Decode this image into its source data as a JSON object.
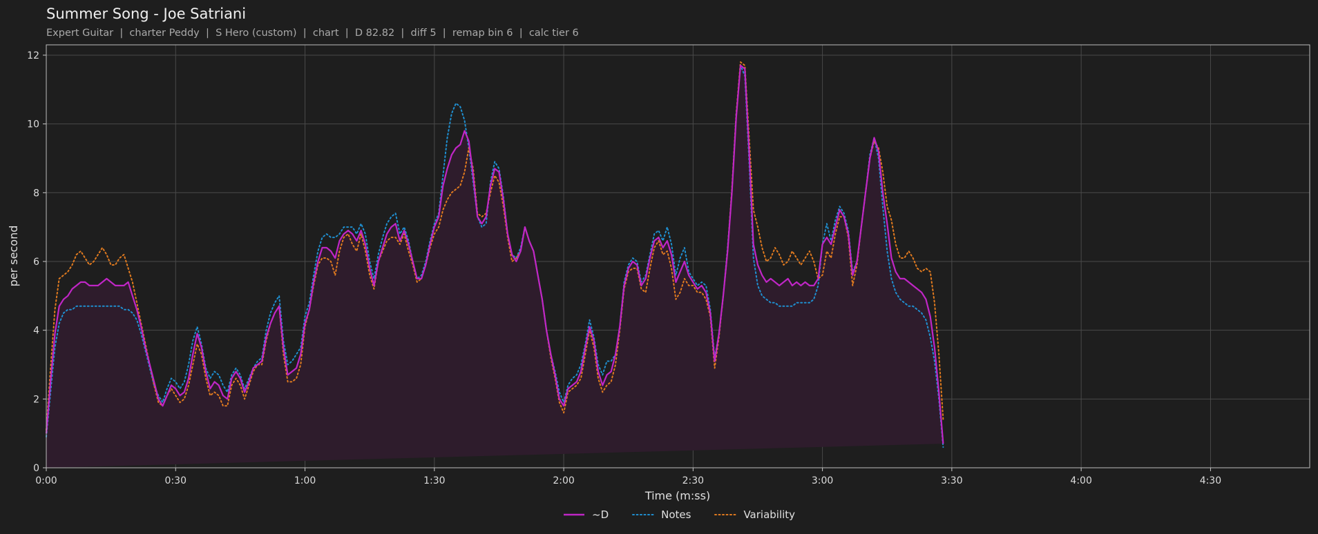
{
  "header": {
    "title": "Summer Song - Joe Satriani",
    "subtitle": "Expert Guitar  |  charter Peddy  |  S Hero (custom)  |  chart  |  D 82.82  |  diff 5  |  remap bin 6  |  calc tier 6"
  },
  "colors": {
    "background": "#1e1e1e",
    "grid": "#4a4a4a",
    "d_series": "#c026c6",
    "notes_series": "#1f8fd0",
    "variability_series": "#e07a1f",
    "fill": "#2e1c2c"
  },
  "chart_data": {
    "type": "line",
    "xlabel": "Time (m:ss)",
    "ylabel": "per second",
    "xlim": [
      0,
      293
    ],
    "ylim": [
      0,
      12.3
    ],
    "grid": true,
    "legend_placement": "bottom-center",
    "x_ticks": [
      {
        "value": 0,
        "label": "0:00"
      },
      {
        "value": 30,
        "label": "0:30"
      },
      {
        "value": 60,
        "label": "1:00"
      },
      {
        "value": 90,
        "label": "1:30"
      },
      {
        "value": 120,
        "label": "2:00"
      },
      {
        "value": 150,
        "label": "2:30"
      },
      {
        "value": 180,
        "label": "3:00"
      },
      {
        "value": 210,
        "label": "3:30"
      },
      {
        "value": 240,
        "label": "4:00"
      },
      {
        "value": 270,
        "label": "4:30"
      }
    ],
    "y_ticks": [
      {
        "value": 0,
        "label": "0"
      },
      {
        "value": 2,
        "label": "2"
      },
      {
        "value": 4,
        "label": "4"
      },
      {
        "value": 6,
        "label": "6"
      },
      {
        "value": 8,
        "label": "8"
      },
      {
        "value": 10,
        "label": "10"
      },
      {
        "value": 12,
        "label": "12"
      }
    ],
    "x": [
      0,
      1,
      2,
      3,
      4,
      5,
      6,
      7,
      8,
      9,
      10,
      11,
      12,
      13,
      14,
      15,
      16,
      17,
      18,
      19,
      20,
      21,
      22,
      23,
      24,
      25,
      26,
      27,
      28,
      29,
      30,
      31,
      32,
      33,
      34,
      35,
      36,
      37,
      38,
      39,
      40,
      41,
      42,
      43,
      44,
      45,
      46,
      47,
      48,
      49,
      50,
      51,
      52,
      53,
      54,
      55,
      56,
      57,
      58,
      59,
      60,
      61,
      62,
      63,
      64,
      65,
      66,
      67,
      68,
      69,
      70,
      71,
      72,
      73,
      74,
      75,
      76,
      77,
      78,
      79,
      80,
      81,
      82,
      83,
      84,
      85,
      86,
      87,
      88,
      89,
      90,
      91,
      92,
      93,
      94,
      95,
      96,
      97,
      98,
      99,
      100,
      101,
      102,
      103,
      104,
      105,
      106,
      107,
      108,
      109,
      110,
      111,
      112,
      113,
      114,
      115,
      116,
      117,
      118,
      119,
      120,
      121,
      122,
      123,
      124,
      125,
      126,
      127,
      128,
      129,
      130,
      131,
      132,
      133,
      134,
      135,
      136,
      137,
      138,
      139,
      140,
      141,
      142,
      143,
      144,
      145,
      146,
      147,
      148,
      149,
      150,
      151,
      152,
      153,
      154,
      155,
      156,
      157,
      158,
      159,
      160,
      161,
      162,
      163,
      164,
      165,
      166,
      167,
      168,
      169,
      170,
      171,
      172,
      173,
      174,
      175,
      176,
      177,
      178,
      179,
      180,
      181,
      182,
      183,
      184,
      185,
      186,
      187,
      188,
      189,
      190,
      191,
      192,
      193,
      194,
      195,
      196,
      197,
      198,
      199,
      200,
      201,
      202,
      203,
      204,
      205,
      206,
      207,
      208,
      209,
      210,
      211,
      212,
      213,
      214,
      215,
      216,
      217,
      218,
      219,
      220,
      221,
      222,
      223,
      224,
      225,
      226,
      227,
      228,
      229,
      230,
      231,
      232,
      233,
      234,
      235,
      236,
      237,
      238,
      239,
      240,
      241,
      242,
      243,
      244,
      245,
      246,
      247,
      248,
      249,
      250,
      251,
      252,
      253,
      254,
      255,
      256,
      257,
      258,
      259,
      260,
      261,
      262,
      263,
      264,
      265,
      266,
      267,
      268,
      269,
      270,
      271,
      272,
      273,
      274,
      275,
      276,
      277,
      278,
      279,
      280,
      281,
      282,
      283,
      284,
      285,
      286,
      287,
      288,
      289,
      290,
      291,
      292,
      293
    ],
    "series": [
      {
        "name": "~D",
        "style": "solid",
        "values": [
          1.0,
          2.5,
          3.9,
          4.7,
          4.9,
          5.0,
          5.2,
          5.3,
          5.4,
          5.4,
          5.3,
          5.3,
          5.3,
          5.4,
          5.5,
          5.4,
          5.3,
          5.3,
          5.3,
          5.4,
          5.0,
          4.6,
          4.1,
          3.5,
          3.0,
          2.5,
          2.0,
          1.8,
          2.1,
          2.4,
          2.3,
          2.1,
          2.2,
          2.6,
          3.3,
          3.9,
          3.5,
          2.8,
          2.3,
          2.5,
          2.4,
          2.1,
          2.0,
          2.6,
          2.8,
          2.6,
          2.2,
          2.5,
          2.9,
          3.0,
          3.1,
          3.8,
          4.2,
          4.5,
          4.7,
          3.5,
          2.7,
          2.8,
          2.9,
          3.3,
          4.2,
          4.6,
          5.4,
          6.0,
          6.4,
          6.4,
          6.3,
          6.1,
          6.6,
          6.8,
          6.9,
          6.8,
          6.6,
          6.9,
          6.5,
          5.8,
          5.3,
          6.0,
          6.4,
          6.8,
          7.0,
          7.1,
          6.6,
          6.9,
          6.5,
          6.0,
          5.5,
          5.5,
          5.9,
          6.5,
          7.0,
          7.3,
          8.2,
          8.7,
          9.1,
          9.3,
          9.4,
          9.8,
          9.5,
          8.5,
          7.3,
          7.1,
          7.3,
          8.2,
          8.7,
          8.6,
          7.8,
          6.8,
          6.2,
          6.0,
          6.3,
          7.0,
          6.6,
          6.3,
          5.6,
          4.9,
          4.0,
          3.3,
          2.7,
          2.0,
          1.8,
          2.3,
          2.4,
          2.5,
          2.8,
          3.5,
          4.1,
          3.7,
          2.8,
          2.4,
          2.7,
          2.8,
          3.3,
          4.1,
          5.3,
          5.8,
          6.0,
          5.9,
          5.3,
          5.5,
          6.1,
          6.6,
          6.7,
          6.4,
          6.6,
          6.2,
          5.4,
          5.7,
          6.0,
          5.6,
          5.4,
          5.2,
          5.3,
          5.1,
          4.5,
          3.1,
          3.9,
          5.0,
          6.3,
          8.0,
          10.2,
          11.7,
          11.6,
          9.2,
          6.5,
          5.9,
          5.6,
          5.4,
          5.5,
          5.4,
          5.3,
          5.4,
          5.5,
          5.3,
          5.4,
          5.3,
          5.4,
          5.3,
          5.3,
          5.5,
          6.5,
          6.7,
          6.5,
          7.0,
          7.5,
          7.3,
          6.8,
          5.6,
          6.0,
          7.0,
          8.0,
          9.0,
          9.6,
          9.2,
          8.0,
          7.1,
          6.1,
          5.7,
          5.5,
          5.5,
          5.4,
          5.3,
          5.2,
          5.1,
          4.9,
          4.4,
          3.5,
          2.2,
          0.7
        ]
      },
      {
        "name": "Notes",
        "style": "dotted",
        "values": [
          0.9,
          2.2,
          3.5,
          4.2,
          4.5,
          4.6,
          4.6,
          4.7,
          4.7,
          4.7,
          4.7,
          4.7,
          4.7,
          4.7,
          4.7,
          4.7,
          4.7,
          4.7,
          4.6,
          4.6,
          4.5,
          4.3,
          3.9,
          3.4,
          2.9,
          2.4,
          2.1,
          1.9,
          2.3,
          2.6,
          2.5,
          2.3,
          2.5,
          3.0,
          3.7,
          4.1,
          3.6,
          2.9,
          2.6,
          2.8,
          2.7,
          2.4,
          2.2,
          2.7,
          2.9,
          2.7,
          2.3,
          2.6,
          2.9,
          3.1,
          3.2,
          4.0,
          4.5,
          4.8,
          5.0,
          3.7,
          3.0,
          3.1,
          3.3,
          3.5,
          4.4,
          4.8,
          5.6,
          6.3,
          6.7,
          6.8,
          6.7,
          6.7,
          6.8,
          7.0,
          7.0,
          7.0,
          6.8,
          7.1,
          6.8,
          6.0,
          5.5,
          6.2,
          6.7,
          7.1,
          7.3,
          7.4,
          6.8,
          7.0,
          6.6,
          6.0,
          5.5,
          5.6,
          6.0,
          6.6,
          7.1,
          7.4,
          8.5,
          9.6,
          10.3,
          10.6,
          10.5,
          10.1,
          9.3,
          8.3,
          7.3,
          7.0,
          7.1,
          8.3,
          8.9,
          8.7,
          7.9,
          6.8,
          6.2,
          6.1,
          6.4,
          7.0,
          6.6,
          6.3,
          5.6,
          4.9,
          4.0,
          3.3,
          2.8,
          2.2,
          1.9,
          2.4,
          2.6,
          2.7,
          3.0,
          3.6,
          4.3,
          3.8,
          3.0,
          2.7,
          3.1,
          3.1,
          3.3,
          4.1,
          5.4,
          5.9,
          6.1,
          6.0,
          5.4,
          5.6,
          6.2,
          6.8,
          6.9,
          6.6,
          7.0,
          6.5,
          5.6,
          6.1,
          6.4,
          5.7,
          5.5,
          5.3,
          5.4,
          5.3,
          4.6,
          3.2,
          3.9,
          5.0,
          6.4,
          8.0,
          10.3,
          11.7,
          11.4,
          8.9,
          6.1,
          5.3,
          5.0,
          4.9,
          4.8,
          4.8,
          4.7,
          4.7,
          4.7,
          4.7,
          4.8,
          4.8,
          4.8,
          4.8,
          4.9,
          5.3,
          6.5,
          7.1,
          6.6,
          7.2,
          7.6,
          7.4,
          6.9,
          5.7,
          6.0,
          7.0,
          8.0,
          9.1,
          9.6,
          9.0,
          7.6,
          6.3,
          5.5,
          5.1,
          4.9,
          4.8,
          4.7,
          4.7,
          4.6,
          4.5,
          4.3,
          3.8,
          3.1,
          2.0,
          0.6
        ]
      },
      {
        "name": "Variability",
        "style": "dotted",
        "values": [
          1.1,
          2.9,
          4.6,
          5.5,
          5.6,
          5.7,
          5.9,
          6.2,
          6.3,
          6.1,
          5.9,
          6.0,
          6.2,
          6.4,
          6.2,
          5.9,
          5.9,
          6.1,
          6.2,
          5.8,
          5.4,
          4.8,
          4.2,
          3.6,
          3.0,
          2.4,
          1.9,
          1.8,
          2.1,
          2.3,
          2.1,
          1.9,
          2.0,
          2.4,
          3.0,
          3.6,
          3.3,
          2.6,
          2.1,
          2.2,
          2.1,
          1.8,
          1.8,
          2.4,
          2.6,
          2.4,
          2.0,
          2.4,
          2.8,
          3.0,
          3.0,
          3.7,
          4.2,
          4.5,
          4.7,
          3.3,
          2.5,
          2.5,
          2.6,
          3.0,
          4.1,
          4.6,
          5.3,
          5.9,
          6.1,
          6.1,
          6.0,
          5.6,
          6.3,
          6.7,
          6.8,
          6.5,
          6.3,
          6.8,
          6.3,
          5.6,
          5.2,
          6.0,
          6.3,
          6.6,
          6.7,
          6.7,
          6.5,
          6.8,
          6.3,
          5.9,
          5.4,
          5.5,
          5.9,
          6.4,
          6.8,
          7.0,
          7.5,
          7.8,
          8.0,
          8.1,
          8.2,
          8.6,
          9.3,
          8.7,
          7.4,
          7.3,
          7.4,
          8.0,
          8.5,
          8.3,
          7.6,
          6.7,
          6.0,
          6.1,
          6.3,
          7.0,
          6.6,
          6.3,
          5.6,
          4.9,
          4.0,
          3.2,
          2.6,
          1.9,
          1.6,
          2.2,
          2.3,
          2.4,
          2.6,
          3.3,
          4.0,
          3.5,
          2.6,
          2.2,
          2.4,
          2.5,
          3.0,
          4.0,
          5.2,
          5.7,
          5.8,
          5.8,
          5.2,
          5.1,
          5.8,
          6.4,
          6.6,
          6.2,
          6.3,
          5.8,
          4.9,
          5.1,
          5.5,
          5.3,
          5.3,
          5.1,
          5.1,
          4.9,
          4.4,
          2.9,
          3.8,
          5.0,
          6.3,
          8.1,
          10.3,
          11.8,
          11.7,
          9.6,
          7.5,
          7.0,
          6.4,
          6.0,
          6.1,
          6.4,
          6.2,
          5.9,
          6.0,
          6.3,
          6.1,
          5.9,
          6.1,
          6.3,
          6.0,
          5.5,
          5.6,
          6.3,
          6.1,
          6.8,
          7.3,
          7.3,
          6.7,
          5.3,
          5.9,
          7.0,
          8.0,
          9.0,
          9.5,
          9.3,
          8.6,
          7.6,
          7.2,
          6.5,
          6.1,
          6.1,
          6.3,
          6.1,
          5.8,
          5.7,
          5.8,
          5.7,
          4.8,
          3.3,
          1.4
        ]
      }
    ]
  }
}
